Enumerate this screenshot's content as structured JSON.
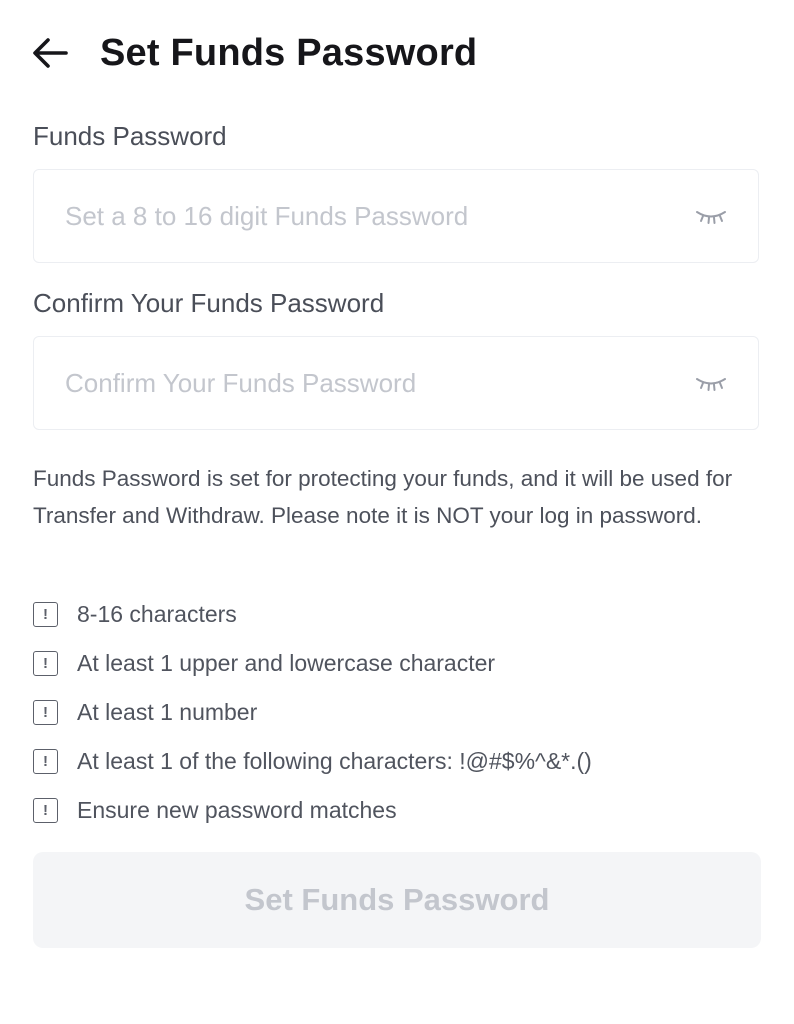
{
  "header": {
    "back_icon": "arrow-left-icon",
    "title": "Set Funds Password"
  },
  "fields": [
    {
      "label": "Funds Password",
      "placeholder": "Set a 8 to 16 digit Funds Password",
      "value": "",
      "toggle_icon": "eye-closed-icon"
    },
    {
      "label": "Confirm Your Funds Password",
      "placeholder": "Confirm Your Funds Password",
      "value": "",
      "toggle_icon": "eye-closed-icon"
    }
  ],
  "note": "Funds Password is set for protecting your funds, and it will be used for Transfer and Withdraw. Please note it is NOT your log in password.",
  "rules": [
    {
      "icon": "exclamation-box-icon",
      "text": "8-16 characters"
    },
    {
      "icon": "exclamation-box-icon",
      "text": "At least 1 upper and lowercase character"
    },
    {
      "icon": "exclamation-box-icon",
      "text": "At least 1 number"
    },
    {
      "icon": "exclamation-box-icon",
      "text": "At least 1 of the following characters: !@#$%^&*.()"
    },
    {
      "icon": "exclamation-box-icon",
      "text": "Ensure new password matches"
    }
  ],
  "submit": {
    "label": "Set Funds Password",
    "disabled": true
  },
  "colors": {
    "title": "#16161a",
    "label": "#4a4e58",
    "placeholder": "#c3c6cd",
    "field_border": "#eceef2",
    "body_text": "#4d515b",
    "button_bg_disabled": "#f4f5f7",
    "button_text_disabled": "#c3c6cd"
  }
}
